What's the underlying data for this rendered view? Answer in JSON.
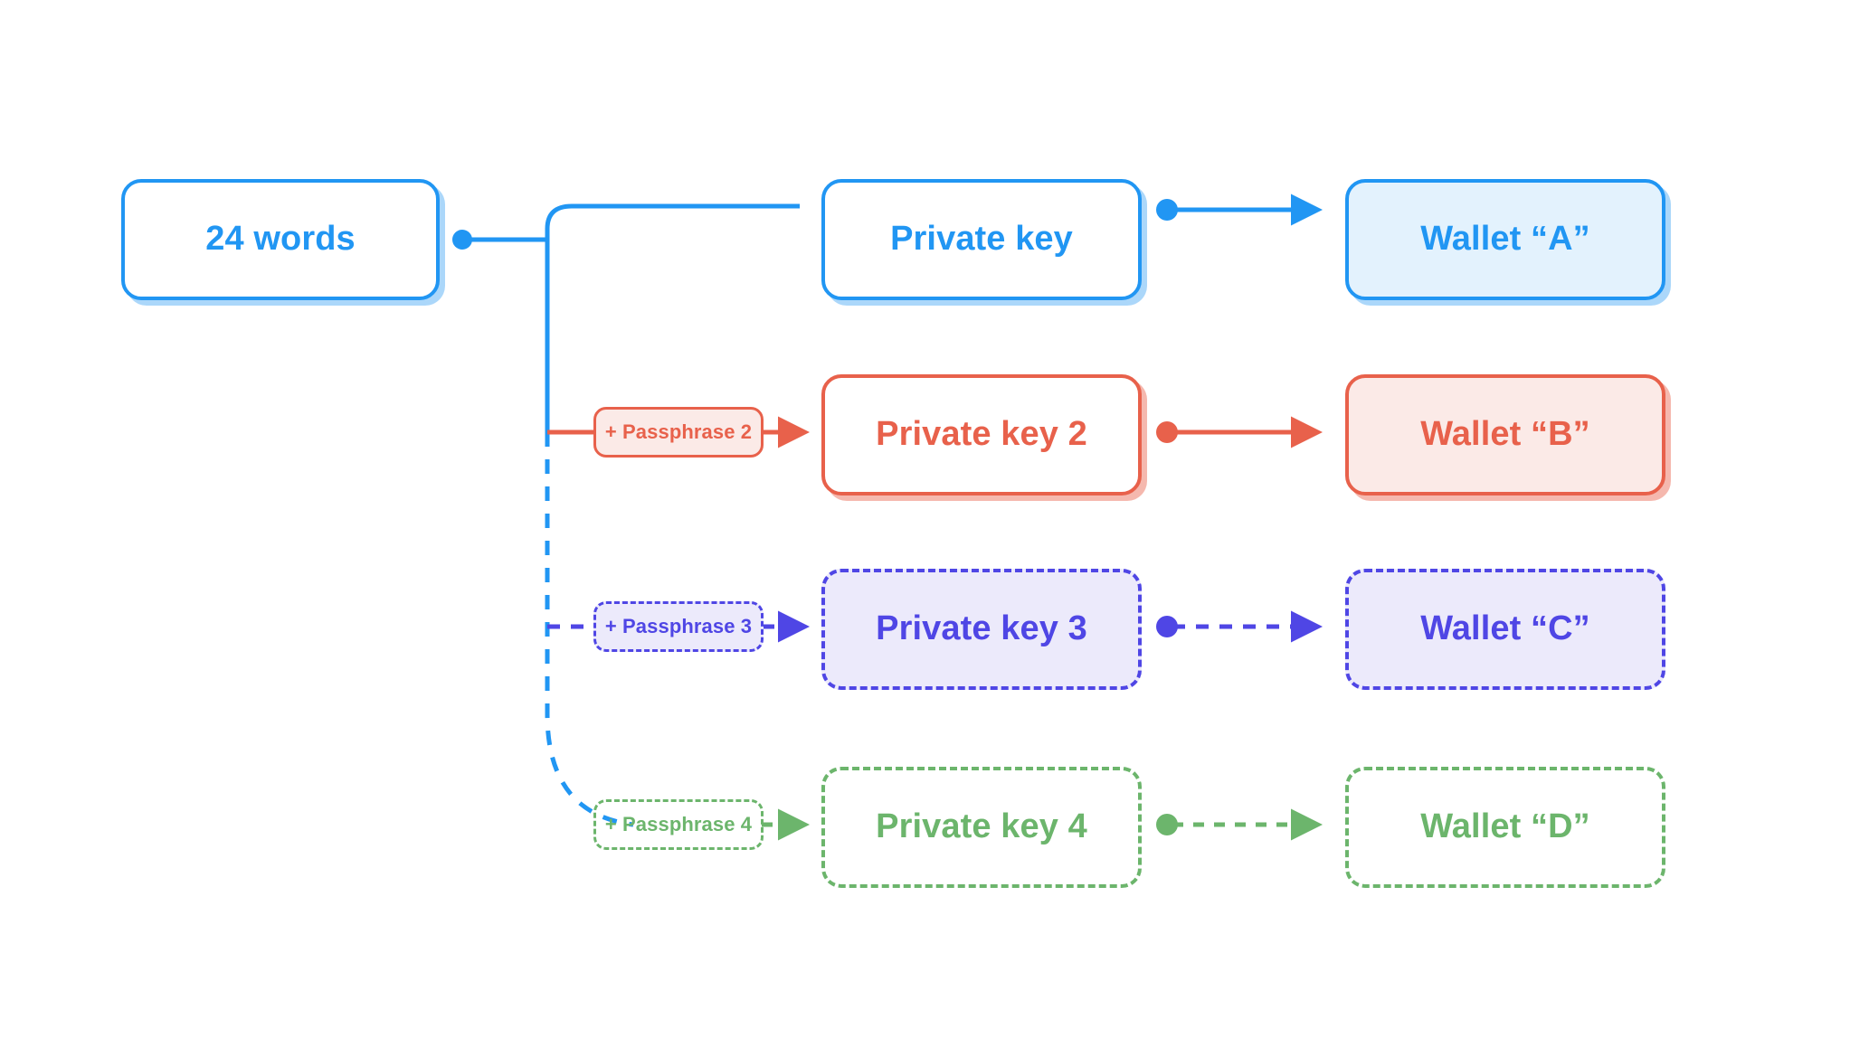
{
  "diagram": {
    "title": "Seed phrase to wallets derivation",
    "background": "#ffffff",
    "rows": [
      {
        "id": "row-a",
        "color": "#2196f3",
        "fill": "#e3f2fd",
        "line_style": "solid",
        "passphrase": null,
        "key_label": "Private key",
        "wallet_label": "Wallet “A”"
      },
      {
        "id": "row-b",
        "color": "#e8614b",
        "fill": "#fbeae7",
        "line_style": "solid",
        "passphrase": "+ Passphrase 2",
        "key_label": "Private key 2",
        "wallet_label": "Wallet “B”"
      },
      {
        "id": "row-c",
        "color": "#4f46e5",
        "fill": "#eceafb",
        "line_style": "dashed",
        "passphrase": "+ Passphrase 3",
        "key_label": "Private key 3",
        "wallet_label": "Wallet “C”"
      },
      {
        "id": "row-d",
        "color": "#6cb56c",
        "fill": "transparent",
        "line_style": "dashed",
        "passphrase": "+ Passphrase 4",
        "key_label": "Private key 4",
        "wallet_label": "Wallet “D”"
      }
    ],
    "source": {
      "label": "24 words",
      "color": "#2196f3"
    }
  }
}
